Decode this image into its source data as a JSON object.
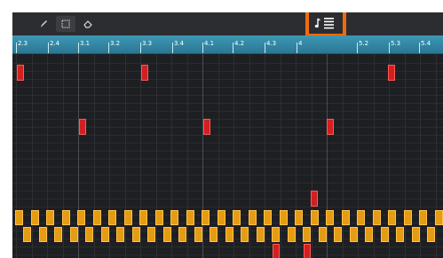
{
  "toolbar": {
    "tools": [
      {
        "name": "pencil-tool-button",
        "icon": "pencil-icon"
      },
      {
        "name": "select-tool-button",
        "icon": "marquee-select-icon"
      },
      {
        "name": "eraser-tool-button",
        "icon": "eraser-icon"
      }
    ],
    "highlighted_button": {
      "icon": "note-list-icon"
    }
  },
  "ruler": {
    "labels": [
      "2.3",
      "2.4",
      "3.1",
      "3.2",
      "3.3",
      "3.4",
      "4.1",
      "4.2",
      "4.3",
      "4",
      "5.2",
      "5.3",
      "5.4"
    ]
  },
  "colors": {
    "highlight": "#f26a0f",
    "ruler": "#3d98b5",
    "note_red": "#d31f1f",
    "note_orange": "#e59c13",
    "background": "#1e1f22"
  }
}
